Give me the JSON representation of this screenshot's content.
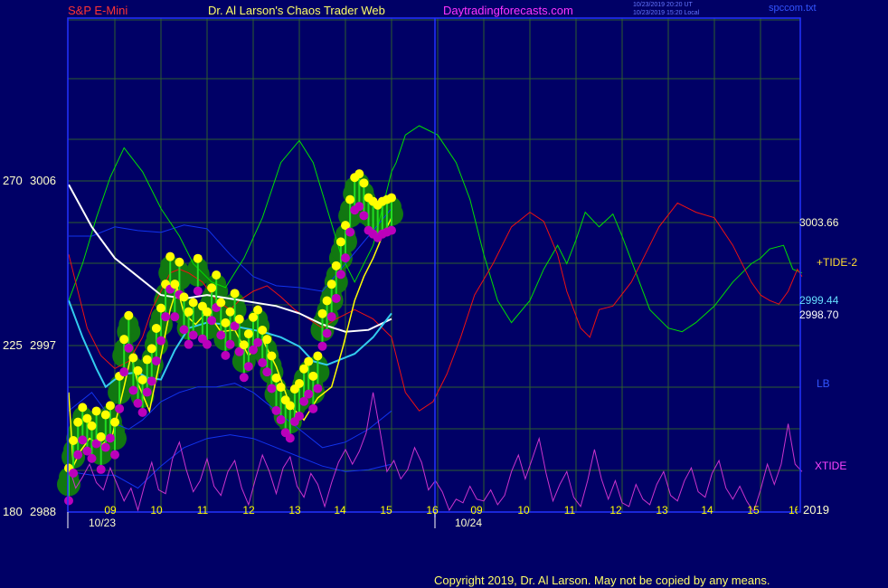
{
  "header": {
    "left_title": "S&P E-Mini",
    "center_title": "Dr. Al Larson's Chaos Trader Web",
    "site": "Daytradingforecasts.com",
    "timestamp_ut": "10/23/2019 20:20 UT",
    "timestamp_local": "10/23/2019 15:20 Local",
    "file_name": "spccom.txt"
  },
  "footer": {
    "copyright": "Copyright 2019, Dr. Al Larson. May not be copied by any means."
  },
  "colors": {
    "background": "#000066",
    "grid": "#2e5e2e",
    "price_bar": "#22dd22",
    "heat_halo": "#117711",
    "high_dot": "#ffff00",
    "low_dot": "#bb00bb",
    "mtide": "#00e000",
    "tide2": "#ee1111",
    "white_ma": "#ffffff",
    "cyan_ma": "#33ccee",
    "bands": "#1133ee",
    "xtide": "#cc33cc",
    "yellow_ma": "#ffff00"
  },
  "chart_data": {
    "type": "line",
    "title": "S&P E-Mini",
    "ylim": [
      2988,
      3006
    ],
    "ylim_left_scale": [
      180,
      270
    ],
    "y_ticks": [
      {
        "left": "270",
        "price": "3006",
        "value": 3006
      },
      {
        "left": "225",
        "price": "2997",
        "value": 2997
      },
      {
        "left": "180",
        "price": "2988",
        "value": 2988
      }
    ],
    "x_ticks": [
      "09",
      "10",
      "11",
      "12",
      "13",
      "14",
      "15",
      "16",
      "09",
      "10",
      "11",
      "12",
      "13",
      "14",
      "15",
      "16"
    ],
    "dates": [
      "10/23",
      "10/24"
    ],
    "grid": true,
    "right_labels": [
      {
        "text": "3003.66",
        "value": 3003.66
      },
      {
        "text": "+TIDE-2",
        "value": 3001.2
      },
      {
        "text": "2999.44",
        "value": 2999.44
      },
      {
        "text": "2998.70",
        "value": 2998.7
      },
      {
        "text": "LB",
        "value": 2995.0
      },
      {
        "text": "XTIDE",
        "value": 2990.2
      },
      {
        "text": "2019",
        "value": 2988.0
      }
    ],
    "series": [
      {
        "key": "mtide",
        "x": [
          0,
          0.3,
          0.6,
          0.9,
          1.2,
          1.6,
          2.0,
          2.4,
          2.7,
          3.1,
          3.4,
          3.8,
          4.2,
          4.6,
          5.0,
          5.3,
          5.6,
          5.9,
          6.2,
          6.6,
          7.0,
          7.1,
          7.3,
          7.6,
          8.0,
          8.4,
          8.7,
          9.0,
          9.3,
          9.6,
          10.0,
          10.3,
          10.6,
          10.8,
          11.0,
          11.2,
          11.5,
          11.8,
          12.0,
          12.3,
          12.6,
          13.0,
          13.3,
          13.6,
          14.0,
          14.4,
          14.8,
          15.0,
          15.2,
          15.5,
          15.7,
          15.9
        ],
        "y": [
          2999.5,
          3001.5,
          3004.0,
          3006.2,
          3007.8,
          3006.5,
          3004.5,
          3003.0,
          3001.5,
          3000.5,
          3000.2,
          3001.8,
          3004.0,
          3007.0,
          3008.2,
          3007.0,
          3004.5,
          3002.0,
          3000.5,
          3002.5,
          3006.5,
          3007.0,
          3008.5,
          3009.0,
          3008.5,
          3007.0,
          3005.0,
          3002.0,
          2999.5,
          2998.3,
          2999.5,
          3001.2,
          3002.5,
          3001.5,
          3002.8,
          3004.3,
          3003.5,
          3004.2,
          3003.0,
          3001.0,
          2999.0,
          2998.0,
          2997.8,
          2998.3,
          2999.2,
          3000.5,
          3001.5,
          3001.8,
          3002.3,
          3002.5,
          3001.2,
          3001.0
        ]
      },
      {
        "key": "tide2",
        "x": [
          0,
          0.2,
          0.4,
          0.7,
          1.0,
          1.3,
          1.6,
          1.8,
          2.0,
          2.2,
          2.4,
          2.6,
          2.9,
          3.2,
          3.5,
          3.7,
          4.0,
          4.3,
          4.6,
          4.9,
          5.2,
          5.5,
          5.8,
          6.2,
          6.6,
          7.0,
          7.3,
          7.6,
          7.9,
          8.2,
          8.5,
          8.8,
          9.2,
          9.6,
          10.0,
          10.3,
          10.6,
          10.8,
          11.1,
          11.3,
          11.5,
          11.8,
          12.2,
          12.5,
          12.8,
          13.2,
          13.6,
          14.0,
          14.4,
          14.8,
          15.0,
          15.2,
          15.4,
          15.6,
          15.8,
          15.9
        ],
        "y": [
          3002.0,
          3000.0,
          2998.0,
          2996.5,
          2995.8,
          2996.2,
          2997.5,
          2999.0,
          3000.0,
          3001.0,
          3001.2,
          3001.0,
          3000.5,
          2999.5,
          2999.0,
          2999.5,
          3000.0,
          3000.3,
          2999.7,
          2999.0,
          2998.5,
          2998.0,
          2998.5,
          2999.0,
          2998.5,
          2997.5,
          2994.5,
          2993.5,
          2994.0,
          2995.5,
          2997.5,
          2999.8,
          3001.5,
          3003.5,
          3004.3,
          3003.8,
          3002.0,
          3000.0,
          2998.0,
          2997.5,
          2999.0,
          2999.2,
          3000.5,
          3002.0,
          3003.5,
          3004.8,
          3004.3,
          3004.0,
          3002.5,
          3000.5,
          2999.8,
          2999.5,
          2999.3,
          3000.0,
          3001.2,
          3000.8
        ]
      },
      {
        "key": "white_ma",
        "x": [
          0,
          0.5,
          1.0,
          1.5,
          2.0,
          2.5,
          3.0,
          3.5,
          4.0,
          4.5,
          5.0,
          5.5,
          6.0,
          6.5,
          7.0
        ],
        "y": [
          3005.8,
          3003.5,
          3001.8,
          3000.8,
          2999.8,
          2999.6,
          2999.8,
          2999.6,
          2999.4,
          2999.2,
          2998.8,
          2998.2,
          2997.8,
          2997.9,
          2998.5
        ]
      },
      {
        "key": "cyan_ma",
        "x": [
          0,
          0.3,
          0.6,
          0.8,
          1.0,
          1.2,
          1.5,
          1.7,
          2.0,
          2.3,
          2.6,
          3.0,
          3.4,
          3.8,
          4.2,
          4.6,
          5.0,
          5.3,
          5.6,
          5.9,
          6.2,
          6.6,
          7.0
        ],
        "y": [
          2999.5,
          2997.5,
          2995.8,
          2994.8,
          2995.2,
          2995.5,
          2995.6,
          2995.3,
          2995.2,
          2996.8,
          2998.0,
          2998.3,
          2998.2,
          2998.0,
          2997.8,
          2997.5,
          2997.0,
          2996.2,
          2996.0,
          2996.3,
          2996.6,
          2997.5,
          2998.8
        ]
      },
      {
        "key": "band_upper",
        "x": [
          0,
          0.5,
          1.0,
          1.5,
          2.0,
          2.5,
          3.0,
          3.5,
          4.0,
          4.5,
          5.0,
          5.5,
          6.0,
          6.5,
          7.0
        ],
        "y": [
          3003.0,
          3003.0,
          3003.5,
          3003.3,
          3003.2,
          3003.6,
          3003.4,
          3002.0,
          3000.8,
          3000.3,
          3000.2,
          3000.0,
          3001.5,
          3003.0,
          3004.5
        ]
      },
      {
        "key": "band_lower",
        "x": [
          0,
          0.5,
          1.0,
          1.3,
          1.6,
          2.0,
          2.4,
          2.8,
          3.2,
          3.6,
          4.0,
          4.5,
          5.0,
          5.5,
          6.0,
          6.5,
          7.0
        ],
        "y": [
          2993.5,
          2994.5,
          2992.8,
          2992.5,
          2993.0,
          2994.0,
          2994.5,
          2994.8,
          2994.8,
          2995.0,
          2994.5,
          2993.5,
          2992.5,
          2991.5,
          2991.8,
          2992.5,
          2993.5
        ]
      },
      {
        "key": "band_lower2",
        "x": [
          0,
          0.5,
          1.0,
          1.5,
          2.0,
          2.5,
          3.0,
          3.5,
          4.0,
          4.5,
          5.0,
          5.5,
          6.0,
          6.5,
          7.0
        ],
        "y": [
          2990.2,
          2990.0,
          2990.0,
          2989.3,
          2990.5,
          2991.5,
          2992.0,
          2992.2,
          2992.0,
          2991.5,
          2991.0,
          2990.5,
          2990.2,
          2990.3,
          2990.6
        ]
      },
      {
        "key": "xtide",
        "x": [
          0,
          0.15,
          0.3,
          0.45,
          0.6,
          0.75,
          0.9,
          1.05,
          1.2,
          1.35,
          1.5,
          1.65,
          1.8,
          1.95,
          2.1,
          2.25,
          2.4,
          2.55,
          2.7,
          2.85,
          3.0,
          3.15,
          3.3,
          3.45,
          3.6,
          3.75,
          3.9,
          4.05,
          4.2,
          4.35,
          4.5,
          4.65,
          4.8,
          4.95,
          5.1,
          5.25,
          5.4,
          5.55,
          5.7,
          5.85,
          6.0,
          6.15,
          6.3,
          6.45,
          6.6,
          6.75,
          6.9,
          7.05,
          7.2,
          7.35,
          7.5,
          7.65,
          7.8,
          7.95,
          8.1,
          8.25,
          8.4,
          8.55,
          8.7,
          8.85,
          9.0,
          9.15,
          9.3,
          9.45,
          9.6,
          9.75,
          9.9,
          10.05,
          10.2,
          10.35,
          10.5,
          10.65,
          10.8,
          10.95,
          11.1,
          11.25,
          11.4,
          11.55,
          11.7,
          11.85,
          12.0,
          12.15,
          12.3,
          12.45,
          12.6,
          12.75,
          12.9,
          13.05,
          13.2,
          13.35,
          13.5,
          13.65,
          13.8,
          13.95,
          14.1,
          14.25,
          14.4,
          14.55,
          14.7,
          14.85,
          15.0,
          15.15,
          15.3,
          15.45,
          15.6,
          15.75,
          15.9
        ],
        "y": [
          2990.5,
          2989.3,
          2989.9,
          2990.6,
          2989.6,
          2989.2,
          2990.4,
          2989.5,
          2988.6,
          2989.3,
          2988.1,
          2989.5,
          2990.7,
          2989.2,
          2989.0,
          2990.9,
          2991.8,
          2990.3,
          2989.1,
          2989.7,
          2990.9,
          2989.4,
          2988.9,
          2990.2,
          2990.8,
          2989.3,
          2988.4,
          2989.8,
          2991.1,
          2990.2,
          2989.0,
          2990.4,
          2991.0,
          2989.4,
          2988.8,
          2990.1,
          2989.5,
          2988.3,
          2989.6,
          2990.7,
          2991.4,
          2990.6,
          2991.3,
          2992.3,
          2994.5,
          2992.4,
          2990.2,
          2990.8,
          2989.8,
          2990.3,
          2991.5,
          2990.7,
          2989.2,
          2989.7,
          2989.1,
          2988.1,
          2988.7,
          2988.5,
          2989.4,
          2988.7,
          2988.6,
          2989.2,
          2988.4,
          2988.9,
          2990.2,
          2991.1,
          2989.8,
          2990.9,
          2992.0,
          2990.1,
          2988.6,
          2989.5,
          2990.2,
          2988.8,
          2988.3,
          2989.7,
          2991.4,
          2989.8,
          2988.7,
          2989.7,
          2988.5,
          2988.3,
          2989.5,
          2988.7,
          2988.4,
          2989.5,
          2990.2,
          2988.9,
          2988.6,
          2989.7,
          2990.4,
          2989.1,
          2988.8,
          2990.1,
          2990.8,
          2989.3,
          2988.7,
          2989.4,
          2988.6,
          2988.0,
          2989.2,
          2990.6,
          2989.5,
          2990.6,
          2992.8,
          2990.6,
          2990.2
        ]
      },
      {
        "key": "yellow_ma",
        "x": [
          0,
          0.1,
          0.25,
          0.45,
          0.7,
          0.95,
          1.2,
          1.35,
          1.5,
          1.75,
          2.0,
          2.2,
          2.35,
          2.5,
          2.75,
          3.0,
          3.3,
          3.6,
          3.9,
          4.2,
          4.5,
          4.8,
          5.1,
          5.4,
          5.7,
          5.95,
          6.2,
          6.4,
          6.6,
          6.8,
          7.0
        ],
        "y": [
          2994.5,
          2990.5,
          2991.3,
          2992.0,
          2991.6,
          2992.2,
          2994.8,
          2996.5,
          2995.0,
          2993.5,
          2996.5,
          2999.0,
          3000.2,
          2998.8,
          2998.2,
          2998.9,
          2997.8,
          2997.9,
          2996.5,
          2997.4,
          2995.9,
          2993.8,
          2993.0,
          2994.2,
          2994.8,
          2997.0,
          2999.5,
          3000.8,
          3001.8,
          3003.0,
          3004.0
        ]
      },
      {
        "key": "price",
        "x": [
          0,
          0.1,
          0.2,
          0.3,
          0.4,
          0.5,
          0.6,
          0.7,
          0.8,
          0.9,
          1.0,
          1.1,
          1.2,
          1.3,
          1.4,
          1.5,
          1.6,
          1.7,
          1.8,
          1.9,
          2.0,
          2.1,
          2.2,
          2.3,
          2.4,
          2.5,
          2.6,
          2.7,
          2.8,
          2.9,
          3.0,
          3.1,
          3.2,
          3.3,
          3.4,
          3.5,
          3.6,
          3.7,
          3.8,
          3.9,
          4.0,
          4.1,
          4.2,
          4.3,
          4.4,
          4.5,
          4.6,
          4.7,
          4.8,
          4.9,
          5.0,
          5.1,
          5.2,
          5.3,
          5.4,
          5.5,
          5.6,
          5.7,
          5.8,
          5.9,
          6.0,
          6.1,
          6.2,
          6.3,
          6.4,
          6.5,
          6.6,
          6.7,
          6.8,
          6.9,
          7.0
        ],
        "y": [
          2989.5,
          2991.0,
          2992.0,
          2992.8,
          2992.2,
          2991.8,
          2992.6,
          2991.2,
          2992.4,
          2992.9,
          2992.0,
          2994.5,
          2996.5,
          2997.8,
          2995.5,
          2994.8,
          2994.3,
          2995.4,
          2996.0,
          2997.1,
          2998.2,
          2999.5,
          3001.0,
          2999.5,
          3000.7,
          2998.8,
          2998.0,
          2998.5,
          3000.9,
          2998.3,
          2998.0,
          2999.3,
          3000.0,
          2998.5,
          2997.4,
          2998.0,
          2999.0,
          2997.6,
          2996.2,
          2996.8,
          2997.7,
          2998.1,
          2997.0,
          2996.5,
          2995.6,
          2994.4,
          2993.9,
          2993.2,
          2992.9,
          2993.8,
          2994.1,
          2994.9,
          2995.3,
          2994.5,
          2995.6,
          2997.9,
          2998.6,
          2999.5,
          3000.5,
          3001.8,
          3002.7,
          3004.1,
          3005.3,
          3005.5,
          3005.0,
          3004.2,
          3004.0,
          3003.8,
          3004.0,
          3004.1,
          3004.2
        ]
      }
    ]
  }
}
